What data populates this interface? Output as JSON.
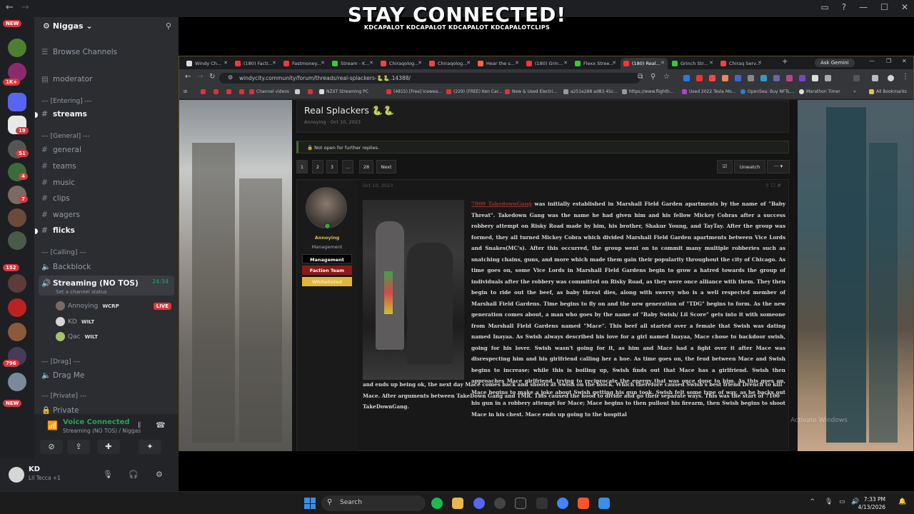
{
  "overlay": {
    "title": "STAY CONNECTED!",
    "handles": "KDCAPALOT  KDCAPALOT  KDCAPALOT  KDCAPALOTCLIPS"
  },
  "discord": {
    "server_name": "Niggas",
    "browse_channels": "Browse Channels",
    "moderator": "moderator",
    "cat_entering": "--- [Entering] ---",
    "ch_streams": "streams",
    "cat_general": "--- [General] ---",
    "ch_general": "general",
    "ch_teams": "teams",
    "ch_music": "music",
    "ch_clips": "clips",
    "ch_wagers": "wagers",
    "ch_flicks": "flicks",
    "cat_calling": "--- [Calling] ---",
    "ch_backblock": "Backblock",
    "ch_streaming": "Streaming (NO TOS)",
    "stream_timer": "24:34",
    "set_status": "Set a channel status",
    "members": [
      {
        "name": "Annoying",
        "tag": "WCRP",
        "live": "LIVE"
      },
      {
        "name": "KD",
        "tag": "WILT",
        "live": ""
      },
      {
        "name": "Qac",
        "tag": "WILT",
        "live": ""
      }
    ],
    "cat_drag": "--- [Drag] ---",
    "ch_dragme": "Drag Me",
    "cat_private": "--- [Private] ---",
    "ch_private": "Private",
    "badges": {
      "new1": "NEW",
      "b1k": "1K+",
      "b19": "19",
      "b51": "51",
      "b4": "4",
      "b7": "7",
      "b152": "152",
      "b796": "796",
      "new2": "NEW"
    },
    "voice": {
      "title": "Voice Connected",
      "sub": "Streaming (NO TOS) / Niggas"
    },
    "user": {
      "name": "KD",
      "status": "Lil Tecca +1"
    }
  },
  "browser": {
    "tabs": [
      "Windy Ch...",
      "(180) Facti...",
      "Fastmoney...",
      "Stream - K...",
      "Chiraqolog...",
      "Chiraqolog...",
      "Hear the s...",
      "(180) Grin...",
      "Flexx Stree...",
      "(180) Real...",
      "Grinch Str...",
      "Chiraq Serv..."
    ],
    "ask_gemini": "Ask Gemini",
    "url": "windycity.community/forum/threads/real-splackers-🐍🐍.14388/",
    "bookmarks": [
      "Channel videos",
      "NZXT Streaming PC",
      "(4815) [Free] Icewea...",
      "(229) (FREE) Ken Car...",
      "New & Used Electri...",
      "a251e288 ad83 45c...",
      "https://www.flighth...",
      "Used 2022 Tesla Mo...",
      "OpenSea: Buy NFTs,...",
      "Marathon Timer",
      "All Bookmarks"
    ]
  },
  "thread": {
    "title": "Real Splackers 🐍🐍",
    "meta": "Annoying · Oct 10, 2023",
    "notice": "Not open for further replies.",
    "pages": [
      "1",
      "2",
      "3",
      "…",
      "28",
      "Next"
    ],
    "unwatch": "Unwatch",
    "more": "··· ▾",
    "post_date": "Oct 10, 2023",
    "author": {
      "name": "Annoying",
      "role": "Management",
      "banners": [
        "Management",
        "Faction Team",
        "Whitelisted"
      ]
    },
    "gang_tag": "7800 TakedownGang",
    "body_side": " was initially established in Marshall Field Garden apartments by the name of \"Baby Threat\". Takedown Gang was the name he had given him and his fellow Mickey Cobras after a success robbery attempt on Risky Road made by him, his brother, Shakur Young, and TayTay. After the group was formed, they all turned Mickey Cobra which divided Marshall Field Garden apartments between Vice Lords and Snakes(MC's). After this occurred, the group went on to commit many multiple robberies such as snatching chains, guns, and more which made them gain their popularity throughout the city of Chicago. As time goes on, some Vice Lords in Marshall Field Gardens begin to grow a hatred towards the group of individuals after the robbery was committed on Risky Road, as they were once alliance with them. They then begin to ride out the beef, as baby threat dies, along with swervy who is a well respected member of Marshall Field Gardens. Time begins to fly on and the new generation of \"TDG\" begins to form. As the new generation comes about, a man who goes by the name of \"Baby Swish/ Lil Score\" gets into it with someone from Marshall Field Gardens named \"Mace\". This beef all started over a female that Swish was dating named Inayaa. As Swish always described his love for a girl named Inayaa, Mace chose to backdoor swish, going for his lover. Swish wasn't going for it, as him and Mace had a fight over it after Mace was disrespecting him and his girlfriend calling her a hoe. As time goes on, the feud between Mace and Swish begins to increase; while this is boiling up, Swish finds out that Mace has a girlfriend. Swish then approaches Mace girlfriend, trying to reciprocate the energy that was once done to him. As this goes on, Mace begins to make a joke about Swish getting his gun took. Swish felt some type of way, as he backs out his gun in a robbery attempt for Mace; Mace begins to then pullout his firearm, then Swish begins to shoot Mace in his chest. Mace ends up going to the hospital",
    "body_wide": "and ends up being ok, the next day Mace comes back and shoots at Swish on the block. Which therefore caused Swish's best friend Drench to kill Mace. After arguments between TakeDown Gang and TMR. This caused the hood to divide and go their separate ways. This was the start of 7100 TakeDownGang.",
    "activate": "Activate Windows"
  },
  "taskbar": {
    "search": "Search",
    "time": "7:33 PM",
    "date": "4/13/2026"
  },
  "colors": {
    "discord_green": "#23a55a",
    "accent_red": "#da373c",
    "management": "#000000",
    "faction": "#8b1a1a",
    "whitelisted": "#e3b63c"
  }
}
